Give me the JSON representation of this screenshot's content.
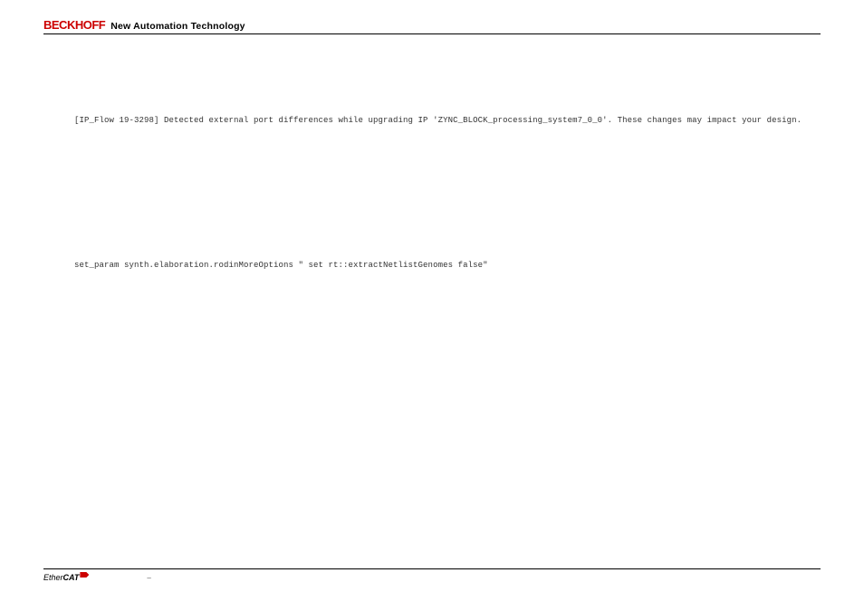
{
  "header": {
    "brand": "BECKHOFF",
    "tagline": "New Automation Technology"
  },
  "body": {
    "line1": "[IP_Flow 19-3298] Detected external port differences while upgrading IP 'ZYNC_BLOCK_processing_system7_0_0'. These changes may impact your design.",
    "line2": "set_param synth.elaboration.rodinMoreOptions \" set rt::extractNetlistGenomes false\""
  },
  "footer": {
    "logo_part1": "Ether",
    "logo_part2": "CAT",
    "page_marker": "–"
  }
}
